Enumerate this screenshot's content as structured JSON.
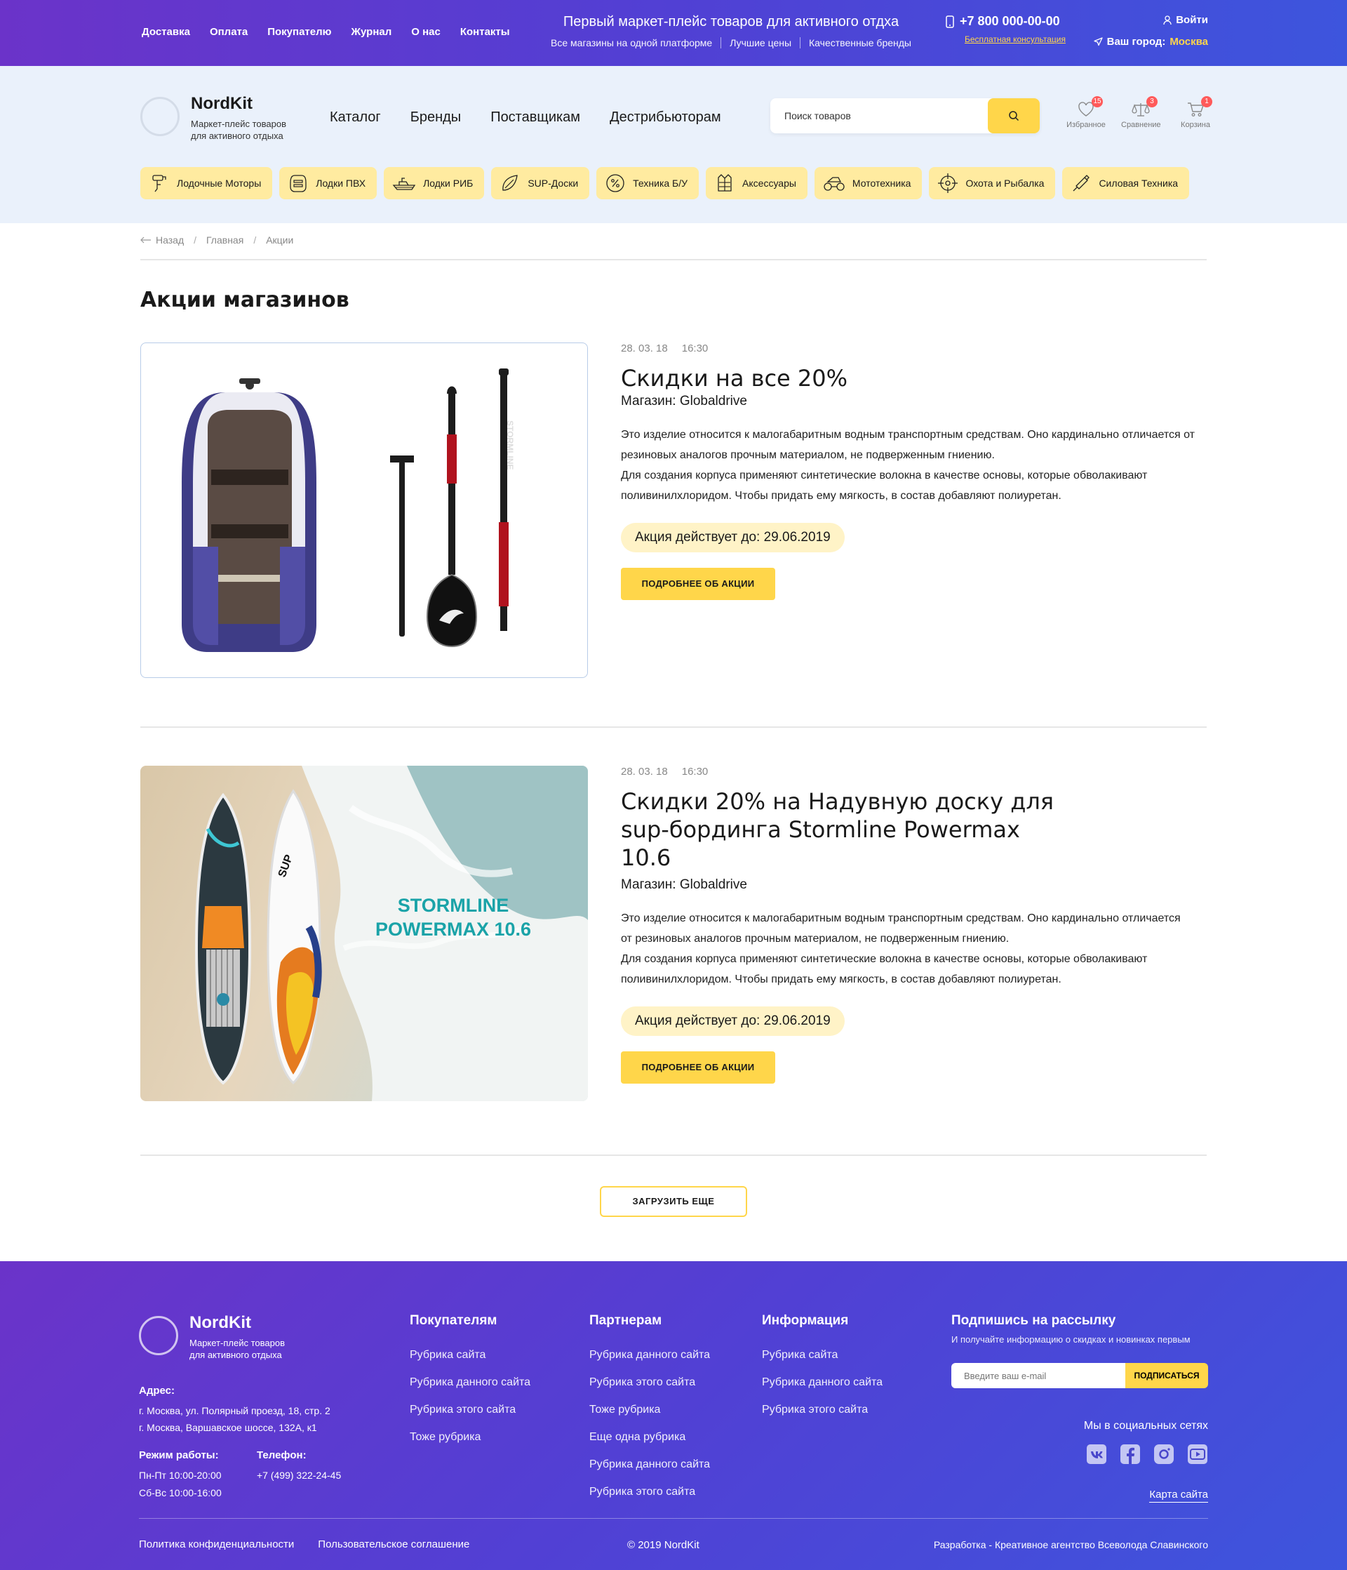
{
  "topbar": {
    "nav": [
      "Доставка",
      "Оплата",
      "Покупателю",
      "Журнал",
      "О нас",
      "Контакты"
    ],
    "headline": "Первый маркет-плейс товаров для активного отдха",
    "features": [
      "Все магазины на одной платформе",
      "Лучшие цены",
      "Качественные бренды"
    ],
    "phone": "+7 800 000-00-00",
    "consult": "Бесплатная консультация",
    "login": "Войти",
    "city_label": "Ваш город:",
    "city": "Москва"
  },
  "header": {
    "logo_name": "NordKit",
    "logo_sub_1": "Маркет-плейс товаров",
    "logo_sub_2": "для активного отдыха",
    "nav": [
      "Каталог",
      "Бренды",
      "Поставщикам",
      "Дестрибьюторам"
    ],
    "search_placeholder": "Поиск товаров",
    "icons": [
      {
        "label": "Избранное",
        "count": "15",
        "icon": "heart-icon"
      },
      {
        "label": "Сравнение",
        "count": "3",
        "icon": "scales-icon"
      },
      {
        "label": "Корзина",
        "count": "1",
        "icon": "cart-icon"
      }
    ],
    "categories": [
      {
        "label": "Лодочные Моторы",
        "icon": "outboard-motor-icon"
      },
      {
        "label": "Лодки ПВХ",
        "icon": "pvc-boat-icon"
      },
      {
        "label": "Лодки РИБ",
        "icon": "rib-boat-icon"
      },
      {
        "label": "SUP-Доски",
        "icon": "sup-board-icon"
      },
      {
        "label": "Техника Б/У",
        "icon": "percent-icon"
      },
      {
        "label": "Аксессуары",
        "icon": "life-vest-icon"
      },
      {
        "label": "Мототехника",
        "icon": "atv-icon"
      },
      {
        "label": "Охота и Рыбалка",
        "icon": "crosshair-icon"
      },
      {
        "label": "Силовая Техника",
        "icon": "chainsaw-icon"
      }
    ]
  },
  "breadcrumbs": [
    "Назад",
    "Главная",
    "Акции"
  ],
  "page_title": "Акции магазинов",
  "promos": [
    {
      "date": "28. 03. 18",
      "time": "16:30",
      "title": "Скидки на все 20%",
      "shop": "Магазин: Globaldrive",
      "text_1": "Это изделие относится к малогабаритным водным транспортным средствам. Оно кардинально отличается от резиновых аналогов прочным материалом, не подверженным гниению.",
      "text_2": "Для создания корпуса применяют синтетические волокна в качестве основы, которые обволакивают поливинилхлоридом. Чтобы придать ему мягкость, в состав добавляют полиуретан.",
      "valid": "Акция действует до: 29.06.2019",
      "button": "ПОДРОБНЕЕ ОБ АКЦИИ",
      "paddle_text": "STORMLINE"
    },
    {
      "date": "28. 03. 18",
      "time": "16:30",
      "title": "Скидки 20% на Надувную доску для sup-бординга Stormline Powermax 10.6",
      "shop": "Магазин: Globaldrive",
      "text_1": "Это изделие относится к малогабаритным водным транспортным средствам. Оно кардинально отличается от резиновых аналогов прочным материалом, не подверженным гниению.",
      "text_2": "Для создания корпуса применяют синтетические волокна в качестве основы, которые обволакивают поливинилхлоридом. Чтобы придать ему мягкость, в состав добавляют полиуретан.",
      "valid": "Акция действует до: 29.06.2019",
      "button": "ПОДРОБНЕЕ ОБ АКЦИИ",
      "image_text_1": "STORMLINE",
      "image_text_2": "POWERMAX 10.6"
    }
  ],
  "load_more": "ЗАГРУЗИТЬ ЕЩЕ",
  "footer": {
    "logo_name": "NordKit",
    "logo_sub_1": "Маркет-плейс товаров",
    "logo_sub_2": "для активного отдыха",
    "address_label": "Адрес:",
    "address_1": "г. Москва, ул. Полярный проезд, 18, стр. 2",
    "address_2": "г. Москва, Варшавское шоссе, 132А, к1",
    "hours_label": "Режим работы:",
    "hours_1": "Пн-Пт 10:00-20:00",
    "hours_2": "Сб-Вс 10:00-16:00",
    "phone_label": "Телефон:",
    "phone": "+7 (499) 322-24-45",
    "col1_title": "Покупателям",
    "col1": [
      "Рубрика сайта",
      "Рубрика данного сайта",
      "Рубрика этого сайта",
      "Тоже рубрика"
    ],
    "col2_title": "Партнерам",
    "col2": [
      "Рубрика данного сайта",
      "Рубрика этого сайта",
      "Тоже рубрика",
      "Еще одна рубрика",
      "Рубрика данного сайта",
      "Рубрика этого сайта"
    ],
    "col3_title": "Информация",
    "col3": [
      "Рубрика сайта",
      "Рубрика данного сайта",
      "Рубрика этого сайта"
    ],
    "subscribe_title": "Подпишись на рассылку",
    "subscribe_text": "И получайте информацию о скидках и новинках первым",
    "email_placeholder": "Введите ваш e-mail",
    "subscribe_button": "ПОДПИСАТЬСЯ",
    "social_title": "Мы в социальных сетях",
    "socials": [
      "vk-icon",
      "facebook-icon",
      "instagram-icon",
      "youtube-icon"
    ],
    "sitemap": "Карта сайта",
    "privacy": "Политика конфиденциальности",
    "agreement": "Пользовательское соглашение",
    "copyright": "© 2019 NordKit",
    "developer": "Разработка - Креативное агентство",
    "developer_name": "Всеволода Славинского"
  },
  "colors": {
    "accent": "#ffd64a",
    "brand_start": "#6b33c9",
    "brand_end": "#3d55dd",
    "badge": "#ff5a5a",
    "header_bg": "#eaf1fb",
    "category_bg": "#ffeba0"
  }
}
